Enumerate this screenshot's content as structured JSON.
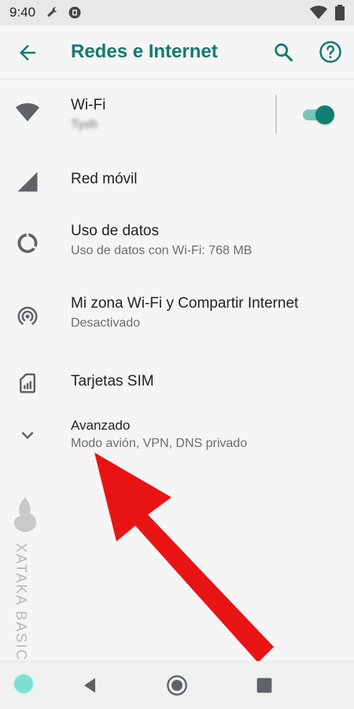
{
  "status": {
    "time": "9:40"
  },
  "app_bar": {
    "title": "Redes e Internet"
  },
  "items": [
    {
      "title": "Wi-Fi",
      "subtitle": "Tyvh"
    },
    {
      "title": "Red móvil",
      "subtitle": ""
    },
    {
      "title": "Uso de datos",
      "subtitle": "Uso de datos con Wi-Fi: 768 MB"
    },
    {
      "title": "Mi zona Wi-Fi y Compartir Internet",
      "subtitle": "Desactivado"
    },
    {
      "title": "Tarjetas SIM",
      "subtitle": ""
    },
    {
      "title": "Avanzado",
      "subtitle": "Modo avión, VPN, DNS privado"
    }
  ],
  "wifi_toggle": {
    "on": true
  },
  "watermark": {
    "text": "XATAKA BASICS"
  },
  "icons": {
    "status": [
      "wrench-icon",
      "shield-icon",
      "wifi-icon",
      "battery-icon"
    ],
    "rows": [
      "wifi-icon",
      "cellular-signal-icon",
      "data-usage-icon",
      "hotspot-icon",
      "sim-card-icon",
      "chevron-down-icon"
    ]
  },
  "colors": {
    "accent": "#157a6e",
    "toggle_on": "#0f7f71",
    "annotation_arrow": "#e81414"
  }
}
